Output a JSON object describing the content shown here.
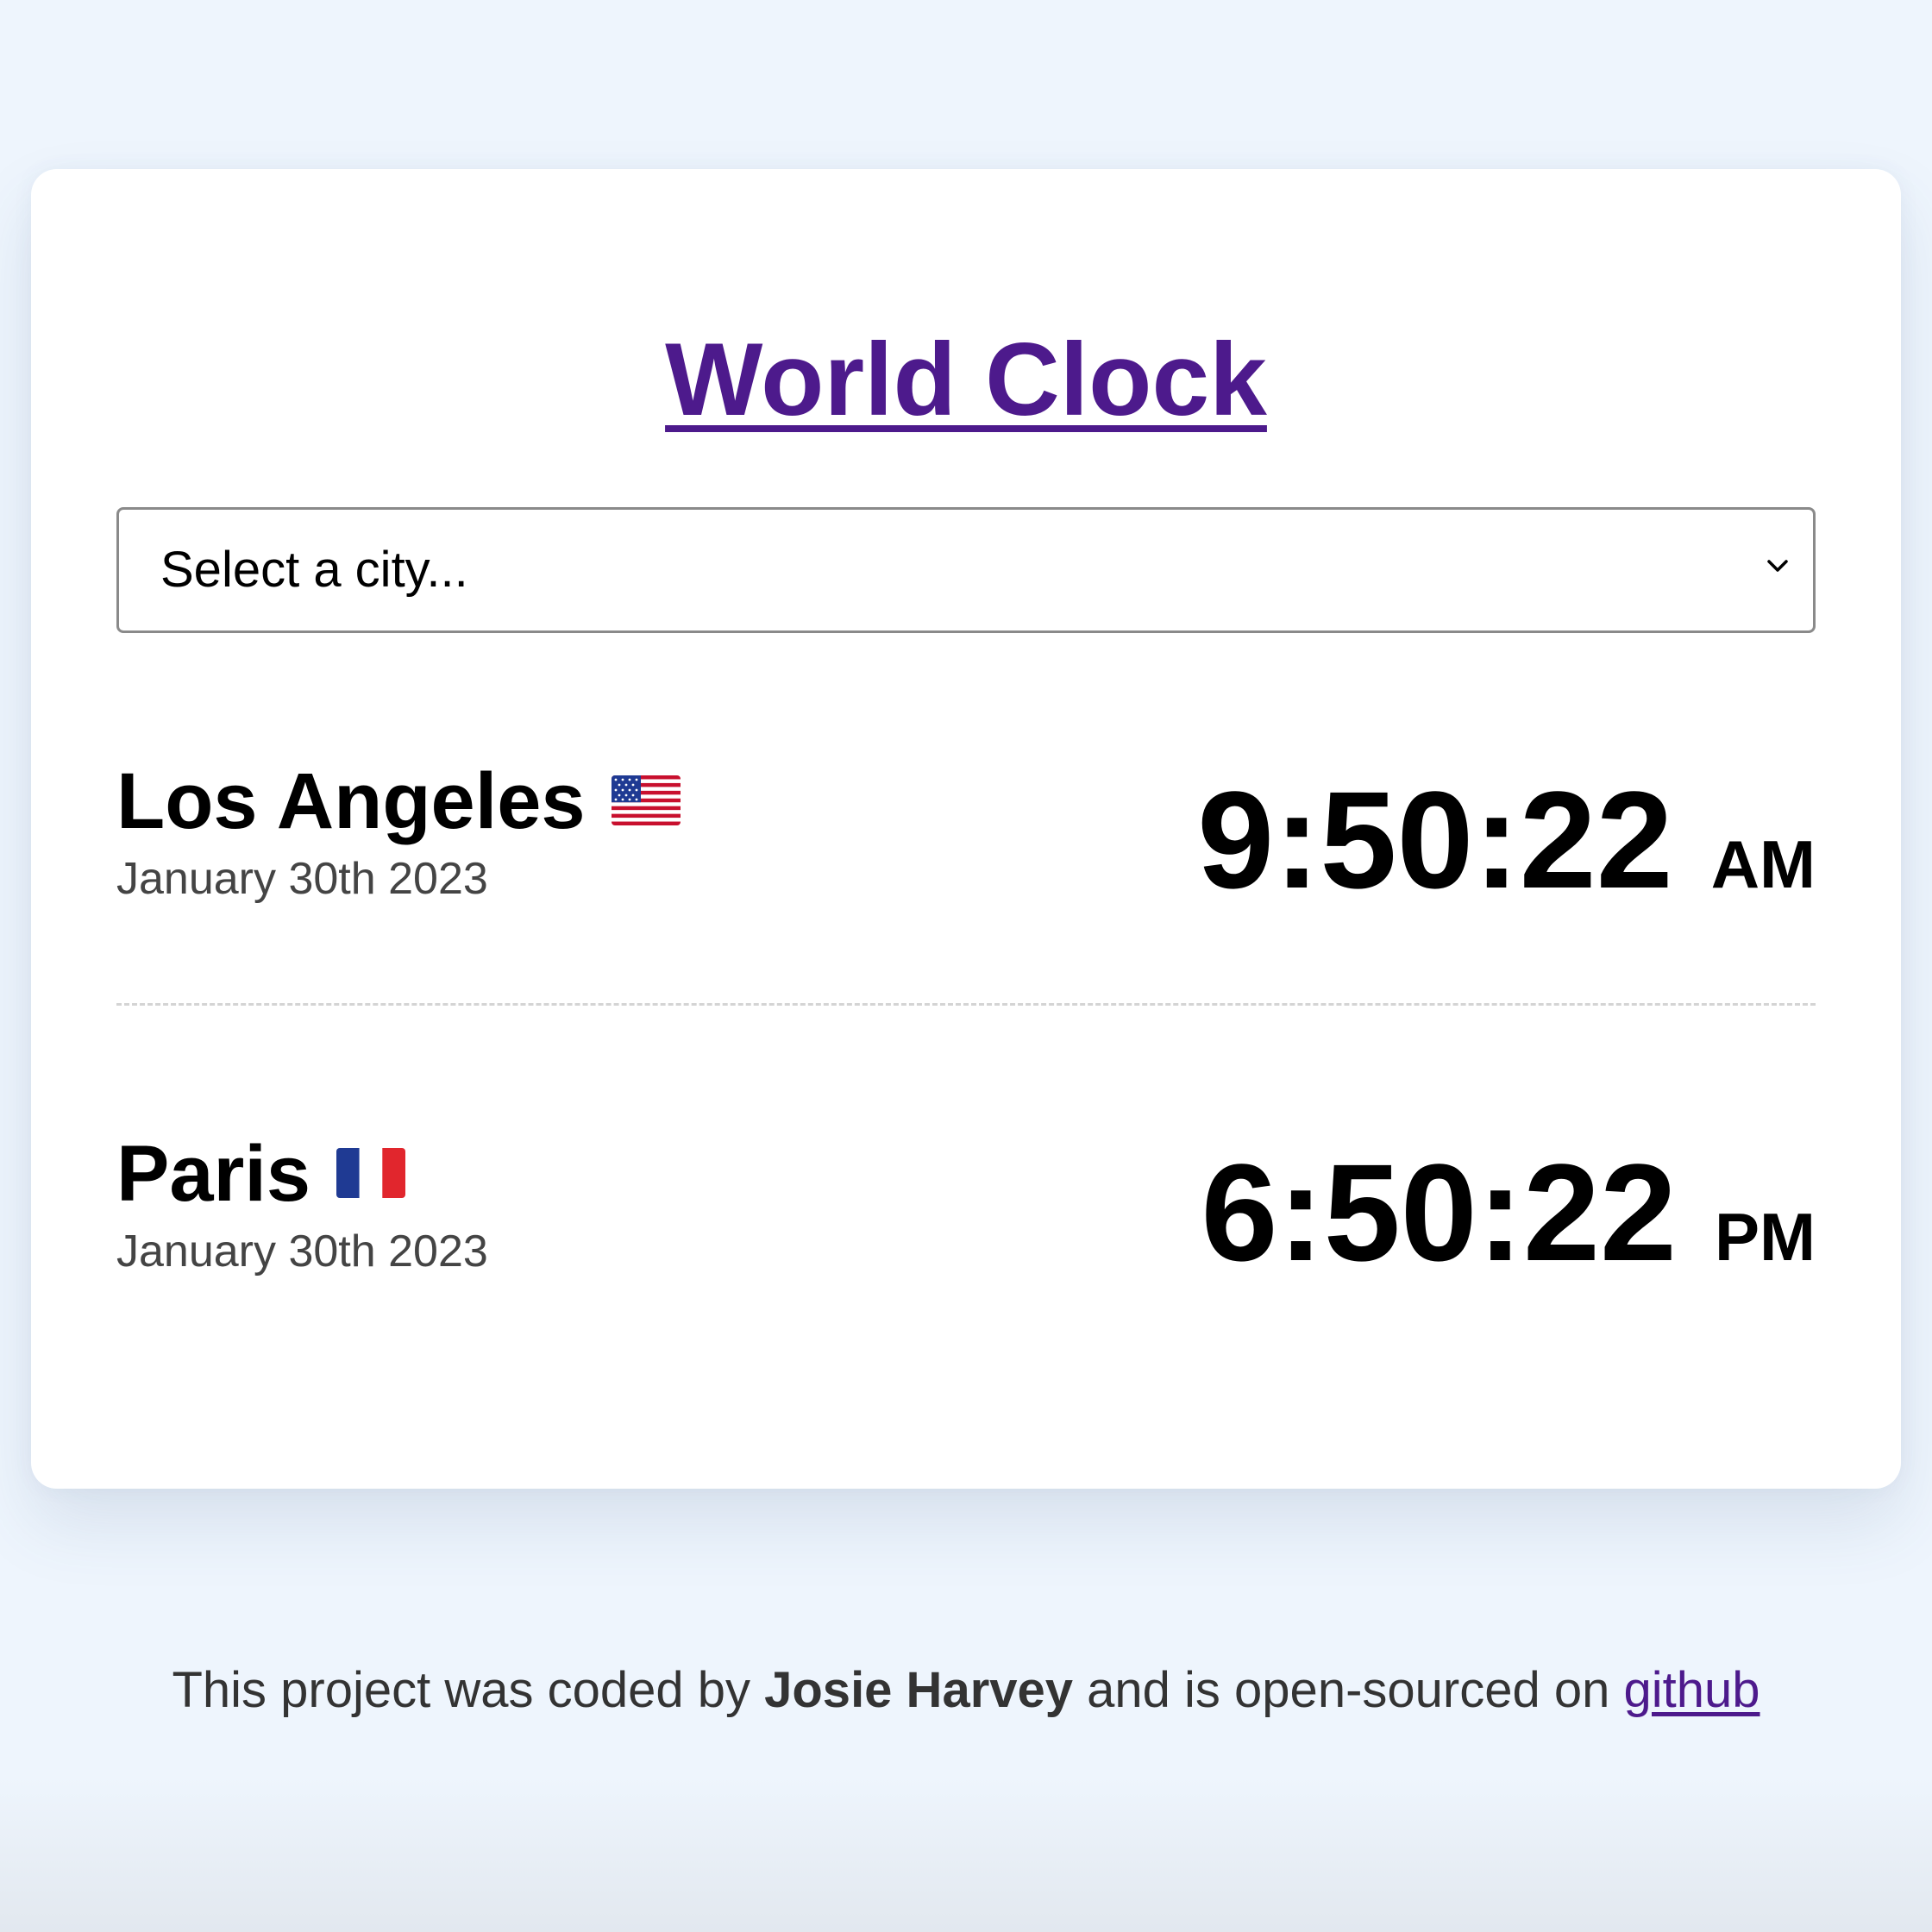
{
  "header": {
    "title": "World Clock"
  },
  "city_select": {
    "value": "Select a city..."
  },
  "cities": [
    {
      "name": "Los Angeles",
      "flag": "us-flag-icon",
      "date": "January 30th 2023",
      "time": "9:50:22",
      "period": "AM"
    },
    {
      "name": "Paris",
      "flag": "fr-flag-icon",
      "date": "January 30th 2023",
      "time": "6:50:22",
      "period": "PM"
    }
  ],
  "footer": {
    "text_before": "This project was coded by ",
    "author": "Josie Harvey",
    "text_middle": " and is open-sourced on ",
    "link_label": "github"
  },
  "colors": {
    "background": "#eef5fd",
    "card": "#ffffff",
    "accent": "#4d1a8c",
    "date_text": "#444444"
  }
}
